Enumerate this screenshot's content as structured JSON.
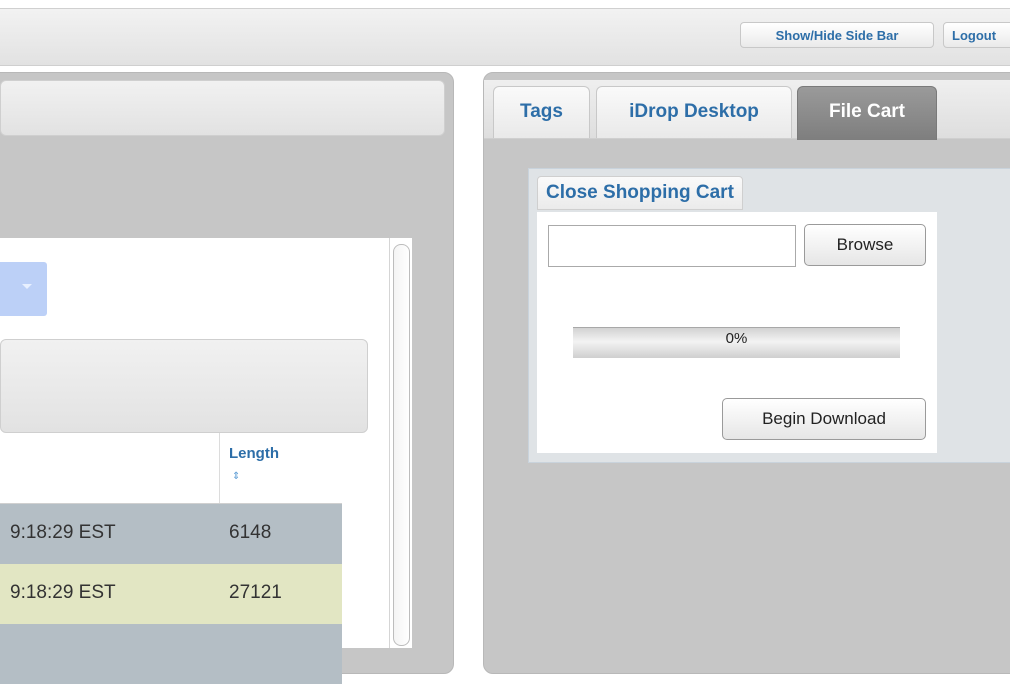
{
  "topbar": {
    "sidebar_toggle_label": "Show/Hide Side Bar",
    "logout_label": "Logout"
  },
  "table": {
    "columns": [
      "",
      "Length"
    ],
    "rows": [
      {
        "time": "9:18:29 EST",
        "length": "6148"
      },
      {
        "time": "9:18:29 EST",
        "length": "27121"
      }
    ]
  },
  "tabs": [
    {
      "label": "Tags",
      "active": false
    },
    {
      "label": "iDrop Desktop",
      "active": false
    },
    {
      "label": "File Cart",
      "active": true
    }
  ],
  "cart": {
    "close_label": "Close Shopping Cart",
    "file_value": "",
    "browse_label": "Browse",
    "progress_fraction": 0,
    "progress_text": "0%",
    "download_label": "Begin Download"
  },
  "colors": {
    "link_blue": "#2d6ea8",
    "row_gray": "#b4bec5",
    "row_yellow": "#e2e6c3",
    "panel_gray": "#c6c6c6",
    "select_blue": "#bcd0f7"
  }
}
